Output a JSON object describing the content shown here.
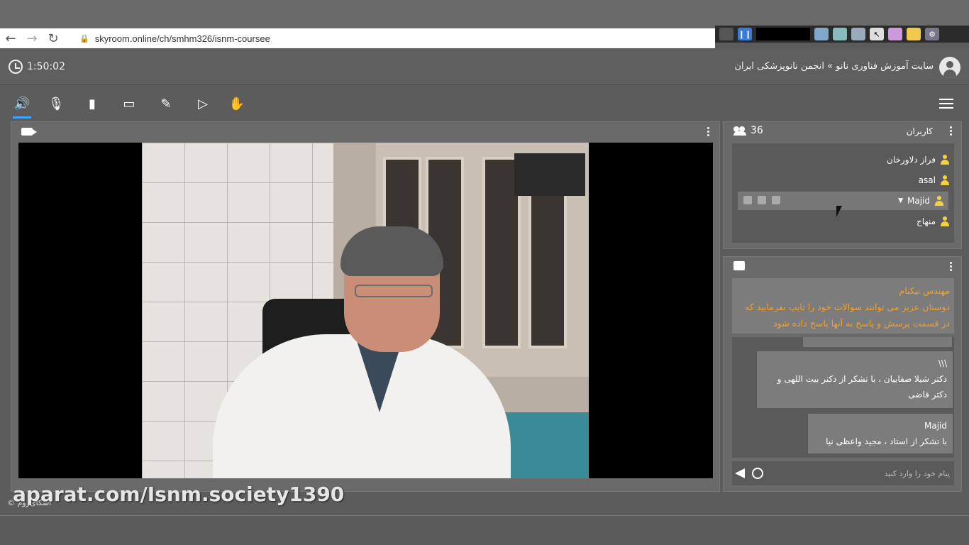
{
  "browser": {
    "url": "skyroom.online/ch/smhm326/isnm-coursee"
  },
  "header": {
    "timer": "1:50:02",
    "site_title": "سایت آموزش فناوری نانو » انجمن نانوپزشکی ایران"
  },
  "toolbar": {
    "icons": [
      "speaker-icon",
      "mic-off-icon",
      "camera-icon",
      "screen-share-icon",
      "brush-icon",
      "media-play-icon",
      "raise-hand-icon"
    ],
    "active": "speaker-icon"
  },
  "users": {
    "title": "کاربران",
    "count": "36",
    "list": [
      {
        "name": "فراز دلاورخان"
      },
      {
        "name": "asal"
      },
      {
        "name": "Majid"
      },
      {
        "name": "منهاج"
      }
    ]
  },
  "chat": {
    "notice_author": "مهندس نیکنام",
    "notice_text": "دوستان عزیز می توانند سوالات خود را تایپ بفرمایید که در قسمت پرسش و پاسخ به آنها پاسخ داده شود",
    "messages": [
      {
        "name": "\\\\\\",
        "text": "دکتر شیلا صفاییان ، با تشکر از دکتر بیت اللهی و دکتر قاضی"
      },
      {
        "name": "Majid",
        "text": "با تشکر از استاد ، مجید واعظی نیا"
      }
    ],
    "input_placeholder": "پیام خود را وارد کنید"
  },
  "watermark": {
    "text": "aparat.com/Isnm.society1390",
    "brand": "اسکای‌روم ©"
  },
  "colors": {
    "accent": "#3ea6ff",
    "notice": "#f0a030",
    "user_icon": "#f5d142"
  }
}
